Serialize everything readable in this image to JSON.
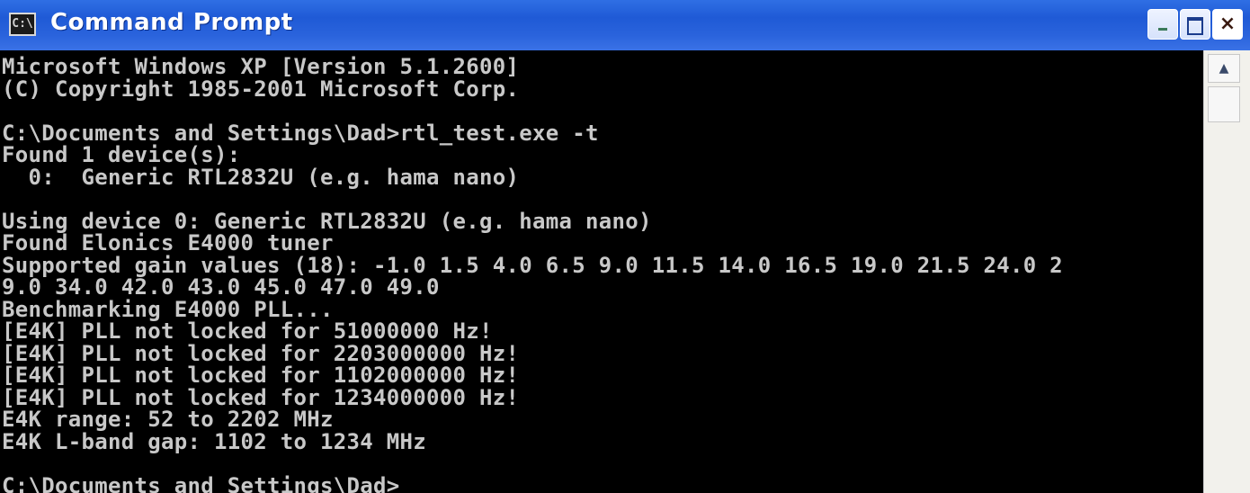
{
  "window": {
    "title": "Command Prompt",
    "icon_label": "C:\\",
    "buttons": {
      "minimize": "minimize",
      "maximize": "maximize",
      "close": "×"
    }
  },
  "console": {
    "lines": [
      "Microsoft Windows XP [Version 5.1.2600]",
      "(C) Copyright 1985-2001 Microsoft Corp.",
      "",
      "C:\\Documents and Settings\\Dad>rtl_test.exe -t",
      "Found 1 device(s):",
      "  0:  Generic RTL2832U (e.g. hama nano)",
      "",
      "Using device 0: Generic RTL2832U (e.g. hama nano)",
      "Found Elonics E4000 tuner",
      "Supported gain values (18): -1.0 1.5 4.0 6.5 9.0 11.5 14.0 16.5 19.0 21.5 24.0 2",
      "9.0 34.0 42.0 43.0 45.0 47.0 49.0",
      "Benchmarking E4000 PLL...",
      "[E4K] PLL not locked for 51000000 Hz!",
      "[E4K] PLL not locked for 2203000000 Hz!",
      "[E4K] PLL not locked for 1102000000 Hz!",
      "[E4K] PLL not locked for 1234000000 Hz!",
      "E4K range: 52 to 2202 MHz",
      "E4K L-band gap: 1102 to 1234 MHz",
      "",
      "C:\\Documents and Settings\\Dad>"
    ]
  },
  "scrollbar": {
    "up_arrow": "▲"
  },
  "colors": {
    "titlebar": "#2a63dc",
    "console_bg": "#000000",
    "console_text": "#c8c8c8"
  }
}
